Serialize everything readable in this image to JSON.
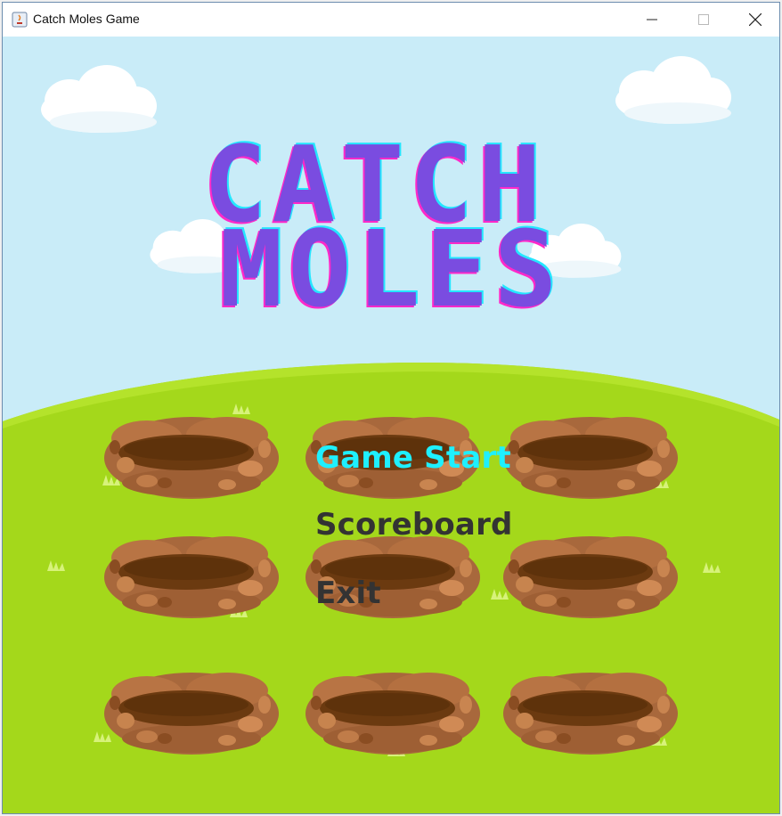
{
  "window": {
    "title": "Catch Moles Game",
    "controls": [
      "minimize",
      "maximize",
      "close"
    ]
  },
  "game": {
    "logo_line1": "CATCH",
    "logo_line2": "MOLES",
    "menu": {
      "start": "Game Start",
      "scoreboard": "Scoreboard",
      "exit": "Exit"
    },
    "holes_count": 9,
    "colors": {
      "sky": "#c9ecf8",
      "grass": "#a4d81b",
      "logo_fill": "#7a4ce0",
      "logo_outline_cyan": "#24e6ff",
      "logo_outline_magenta": "#ff29c9",
      "menu_selected": "#1ef0ff",
      "menu_default": "#333333",
      "dirt": "#a8683c",
      "hole": "#6b3a10"
    }
  }
}
